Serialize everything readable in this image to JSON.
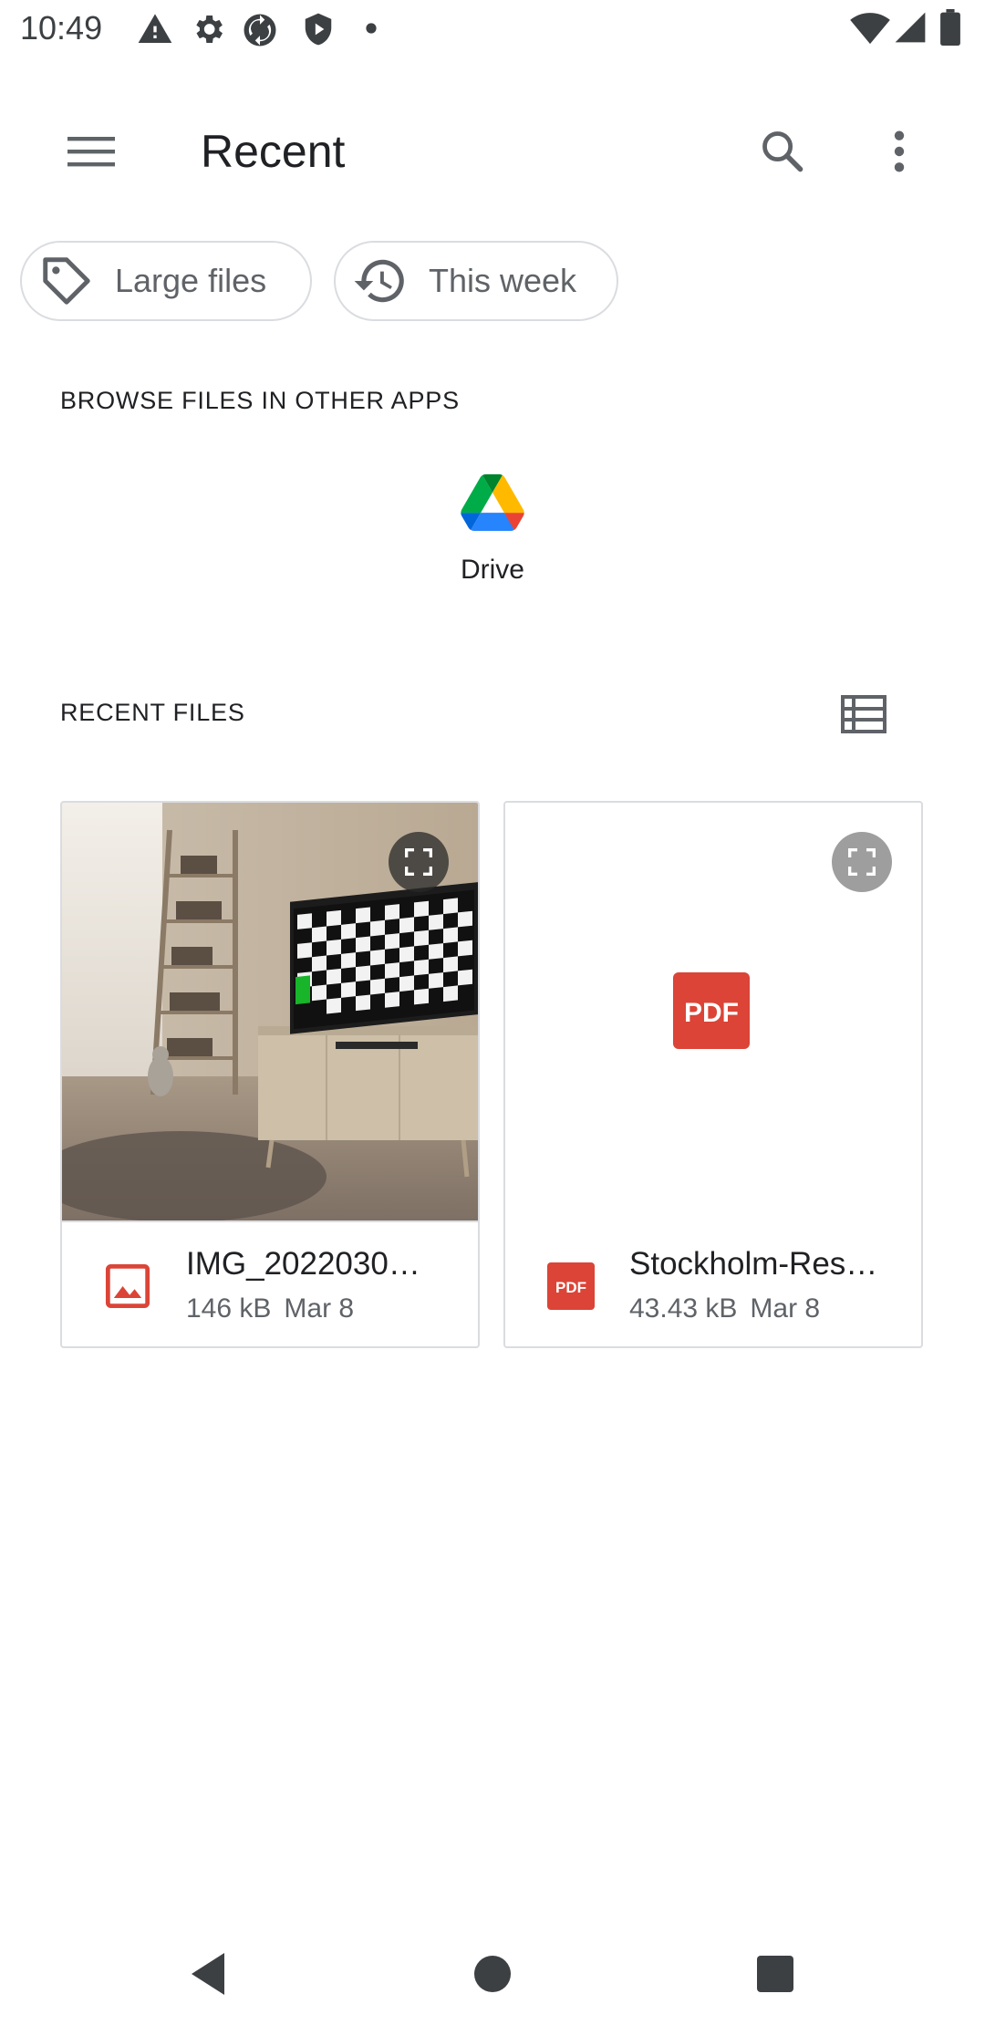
{
  "status_bar": {
    "time": "10:49",
    "left_icons": [
      "warning-icon",
      "settings-icon",
      "sync-icon",
      "shield-icon",
      "dot-icon"
    ],
    "right_icons": [
      "wifi-icon",
      "signal-icon",
      "battery-icon"
    ]
  },
  "app_bar": {
    "title": "Recent",
    "menu_icon": "hamburger-menu-icon",
    "search_icon": "search-icon",
    "more_icon": "more-vert-icon"
  },
  "filters": [
    {
      "label": "Large files",
      "icon": "tag-icon"
    },
    {
      "label": "This week",
      "icon": "history-icon"
    }
  ],
  "browse_section": {
    "header": "BROWSE FILES IN OTHER APPS",
    "apps": [
      {
        "label": "Drive",
        "icon": "google-drive-icon"
      }
    ]
  },
  "recent_section": {
    "header": "RECENT FILES",
    "view_toggle_icon": "list-view-icon",
    "files": [
      {
        "name": "IMG_2022030…",
        "size": "146 kB",
        "date": "Mar 8",
        "type_icon": "image-file-icon",
        "thumb": "room-photo"
      },
      {
        "name": "Stockholm-Res…",
        "size": "43.43 kB",
        "date": "Mar 8",
        "type_icon": "pdf-file-icon",
        "thumb": "pdf"
      }
    ]
  },
  "thumbnail_labels": {
    "pdf_badge": "PDF",
    "pdf_small_badge": "PDF"
  },
  "nav_bar": {
    "icons": [
      "back-icon",
      "home-icon",
      "recents-icon"
    ]
  },
  "colors": {
    "accent_red": "#db4437",
    "drive_green": "#0f9d58",
    "drive_yellow": "#f4b400",
    "drive_blue": "#4285f4",
    "chip_border": "#dadce0",
    "text_secondary": "#5f6368"
  }
}
